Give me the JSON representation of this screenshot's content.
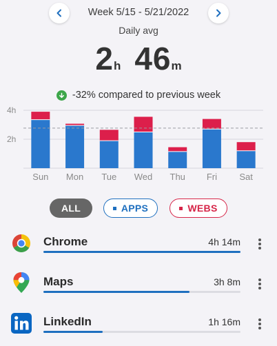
{
  "header": {
    "week_label": "Week 5/15 - 5/21/2022",
    "daily_avg_label": "Daily avg",
    "total": {
      "hours": "2",
      "hours_unit": "h",
      "minutes": "46",
      "minutes_unit": "m"
    },
    "comparison": "-32% compared to previous week"
  },
  "chart_data": {
    "type": "bar",
    "stacked": true,
    "categories": [
      "Sun",
      "Mon",
      "Tue",
      "Wed",
      "Thu",
      "Fri",
      "Sat"
    ],
    "series": [
      {
        "values": [
          3.35,
          2.95,
          1.9,
          2.5,
          1.15,
          2.7,
          1.2
        ],
        "color": "#2a78cd"
      },
      {
        "values": [
          0.55,
          0.12,
          0.75,
          1.05,
          0.3,
          0.7,
          0.6
        ],
        "color": "#dc1f4b"
      }
    ],
    "yticks": [
      "4h",
      "2h"
    ],
    "ylim": [
      0,
      4
    ],
    "average_line": 2.77,
    "grid": true
  },
  "filters": {
    "all": "ALL",
    "apps": "APPS",
    "webs": "WEBS",
    "selected": "all"
  },
  "apps": [
    {
      "name": "Chrome",
      "time": "4h 14m",
      "usage_fraction": 1.0,
      "icon": "chrome-icon"
    },
    {
      "name": "Maps",
      "time": "3h 8m",
      "usage_fraction": 0.74,
      "icon": "google-maps-icon"
    },
    {
      "name": "LinkedIn",
      "time": "1h 16m",
      "usage_fraction": 0.3,
      "icon": "linkedin-icon"
    }
  ],
  "colors": {
    "apps": "#1e6fbf",
    "webs": "#d62548",
    "all_bg": "#666666",
    "positive": "#3da64a"
  }
}
